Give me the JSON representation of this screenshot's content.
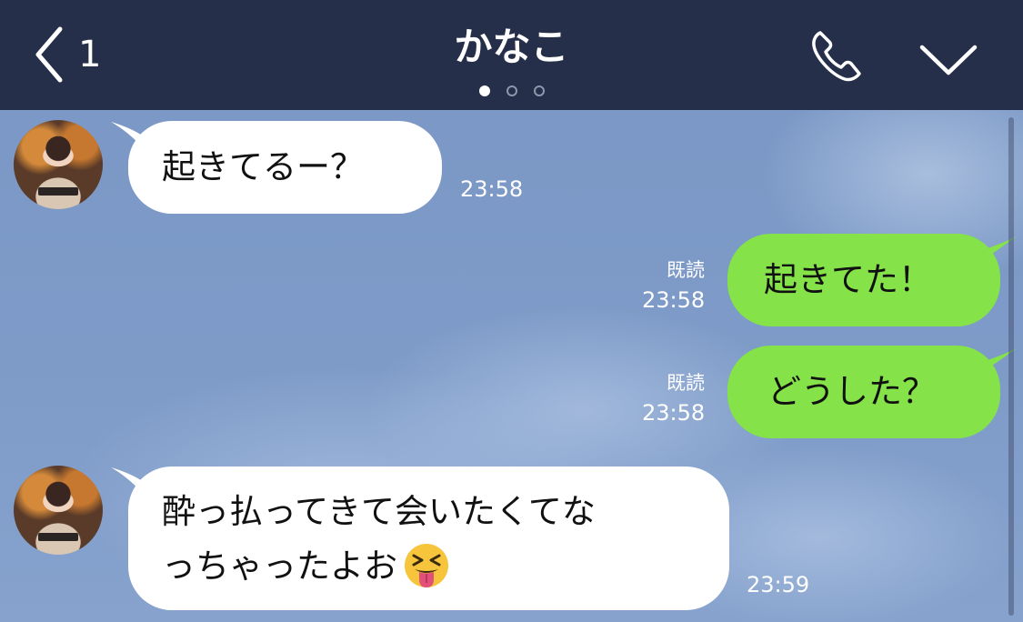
{
  "header": {
    "back_count": "1",
    "title": "かなこ",
    "page_dots": 3,
    "active_dot": 0,
    "icons": [
      "back-chevron-icon",
      "phone-icon",
      "chevron-down-icon"
    ]
  },
  "colors": {
    "header_bg": "#252f4a",
    "chat_bg": "#7f9cc8",
    "incoming_bubble": "#ffffff",
    "outgoing_bubble": "#85e249"
  },
  "messages": [
    {
      "direction": "incoming",
      "text": "起きてるー？",
      "time": "23:58"
    },
    {
      "direction": "outgoing",
      "text": "起きてた！",
      "read": "既読",
      "time": "23:58"
    },
    {
      "direction": "outgoing",
      "text": "どうした？",
      "read": "既読",
      "time": "23:58"
    },
    {
      "direction": "incoming",
      "line1": "酔っ払ってきて会いたくてな",
      "line2": "っちゃったよお",
      "emoji": "squinting-face-with-tongue",
      "time": "23:59"
    }
  ]
}
